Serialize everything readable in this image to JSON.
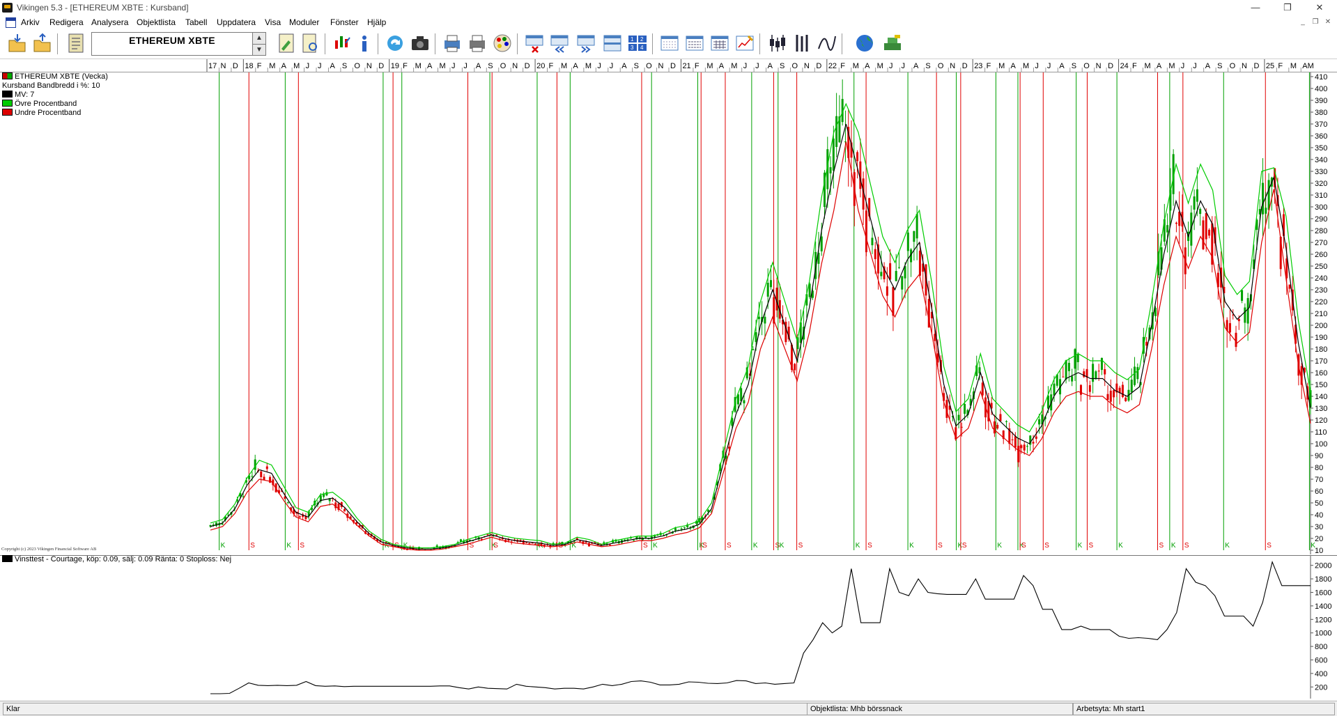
{
  "window": {
    "title": "Vikingen 5.3 - [ETHEREUM XBTE : Kursband]",
    "controls": {
      "minimize": "—",
      "maximize": "❐",
      "close": "✕"
    }
  },
  "menu": {
    "items": [
      "Arkiv",
      "Redigera",
      "Analysera",
      "Objektlista",
      "Tabell",
      "Uppdatera",
      "Visa",
      "Moduler",
      "Fönster",
      "Hjälp"
    ]
  },
  "toolbar": {
    "symbol": "ETHEREUM XBTE",
    "spin_up": "▲",
    "spin_down": "▼"
  },
  "legend": {
    "items": [
      {
        "label": "ETHEREUM XBTE (Vecka)",
        "color": "#cc0000",
        "color2": "#00aa00"
      },
      {
        "label": "Kursband  Bandbredd i %: 10",
        "color": ""
      },
      {
        "label": "MV: 7",
        "color": "#000000"
      },
      {
        "label": "Övre Procentband",
        "color": "#00cc00"
      },
      {
        "label": "Undre Procentband",
        "color": "#dd0000"
      }
    ]
  },
  "copyright": "Copyright (c) 2023 Vikingen Financial Software AB",
  "sub_legend": "Vinsttest - Courtage, köp: 0.09, sälj: 0.09  Ränta: 0  Stoploss: Nej",
  "status": {
    "left": "Klar",
    "middle": "Objektlista: Mhb börssnack",
    "right": "Arbetsyta: Mh start1"
  },
  "colors": {
    "buy": "#00a000",
    "sell": "#e00000",
    "ma": "#000000",
    "upper_band": "#00cc00",
    "lower_band": "#dd0000"
  },
  "chart_data": [
    {
      "type": "line",
      "name": "kursband",
      "series": [
        {
          "name": "MV: 7",
          "values": [
            30,
            33,
            45,
            65,
            78,
            75,
            58,
            42,
            38,
            52,
            54,
            46,
            34,
            24,
            17,
            14,
            12,
            11,
            11,
            12,
            14,
            17,
            20,
            23,
            20,
            18,
            17,
            16,
            14,
            15,
            19,
            17,
            14,
            16,
            18,
            20,
            20,
            22,
            26,
            28,
            32,
            45,
            85,
            125,
            150,
            200,
            230,
            200,
            170,
            215,
            280,
            330,
            370,
            330,
            290,
            250,
            230,
            255,
            270,
            215,
            150,
            115,
            125,
            160,
            125,
            115,
            105,
            100,
            115,
            140,
            155,
            160,
            155,
            155,
            145,
            140,
            148,
            200,
            260,
            305,
            275,
            305,
            285,
            220,
            205,
            215,
            300,
            325,
            265,
            185,
            130
          ]
        },
        {
          "name": "Övre Procentband",
          "values": [
            33,
            36,
            49,
            71,
            86,
            82,
            64,
            46,
            42,
            57,
            59,
            51,
            37,
            26,
            19,
            15,
            13,
            12,
            12,
            13,
            15,
            19,
            22,
            25,
            22,
            20,
            19,
            18,
            15,
            16,
            21,
            19,
            15,
            18,
            20,
            22,
            22,
            24,
            29,
            31,
            35,
            50,
            94,
            138,
            165,
            220,
            253,
            220,
            187,
            237,
            308,
            363,
            387,
            363,
            319,
            275,
            253,
            280,
            297,
            237,
            165,
            127,
            138,
            176,
            138,
            127,
            116,
            110,
            127,
            154,
            170,
            176,
            170,
            170,
            160,
            154,
            163,
            220,
            286,
            336,
            303,
            336,
            314,
            242,
            226,
            237,
            330,
            333,
            292,
            204,
            143
          ]
        },
        {
          "name": "Undre Procentband",
          "values": [
            27,
            30,
            41,
            59,
            70,
            68,
            52,
            38,
            34,
            47,
            49,
            41,
            31,
            22,
            15,
            13,
            11,
            10,
            10,
            11,
            13,
            15,
            18,
            21,
            18,
            16,
            15,
            14,
            13,
            14,
            17,
            15,
            13,
            14,
            16,
            18,
            18,
            20,
            23,
            25,
            29,
            41,
            77,
            113,
            135,
            180,
            207,
            180,
            153,
            194,
            252,
            297,
            355,
            297,
            261,
            225,
            207,
            230,
            243,
            194,
            135,
            104,
            113,
            144,
            113,
            104,
            95,
            90,
            104,
            126,
            140,
            144,
            140,
            140,
            131,
            126,
            133,
            180,
            234,
            275,
            248,
            275,
            257,
            198,
            185,
            194,
            270,
            315,
            239,
            167,
            117
          ]
        }
      ],
      "ylim": [
        10,
        410
      ],
      "y_ticks": [
        10,
        20,
        30,
        40,
        50,
        60,
        70,
        80,
        90,
        100,
        110,
        120,
        130,
        140,
        150,
        160,
        170,
        180,
        190,
        200,
        210,
        220,
        230,
        240,
        250,
        260,
        270,
        280,
        290,
        300,
        310,
        320,
        330,
        340,
        350,
        360,
        370,
        380,
        390,
        400,
        410
      ],
      "time_axis": [
        "17",
        "N",
        "D",
        "18",
        "F",
        "M",
        "A",
        "M",
        "J",
        "J",
        "A",
        "S",
        "O",
        "N",
        "D",
        "19",
        "F",
        "M",
        "A",
        "M",
        "J",
        "J",
        "A",
        "S",
        "O",
        "N",
        "D",
        "20",
        "F",
        "M",
        "A",
        "M",
        "J",
        "J",
        "A",
        "S",
        "O",
        "N",
        "D",
        "21",
        "F",
        "M",
        "A",
        "M",
        "J",
        "J",
        "A",
        "S",
        "O",
        "N",
        "D",
        "22",
        "F",
        "M",
        "A",
        "M",
        "J",
        "J",
        "A",
        "S",
        "O",
        "N",
        "D",
        "23",
        "F",
        "M",
        "A",
        "M",
        "J",
        "J",
        "A",
        "S",
        "O",
        "N",
        "D",
        "24",
        "F",
        "M",
        "A",
        "M",
        "J",
        "J",
        "A",
        "S",
        "O",
        "N",
        "D",
        "25",
        "F",
        "M",
        "AM"
      ],
      "signals": [
        {
          "label": "K",
          "pos": 0.008
        },
        {
          "label": "S",
          "pos": 0.035
        },
        {
          "label": "K",
          "pos": 0.068
        },
        {
          "label": "S",
          "pos": 0.08
        },
        {
          "label": "K",
          "pos": 0.157
        },
        {
          "label": "S",
          "pos": 0.166
        },
        {
          "label": "K",
          "pos": 0.174
        },
        {
          "label": "S",
          "pos": 0.234
        },
        {
          "label": "K",
          "pos": 0.254
        },
        {
          "label": "S",
          "pos": 0.256
        },
        {
          "label": "K",
          "pos": 0.297
        },
        {
          "label": "S",
          "pos": 0.315
        },
        {
          "label": "K",
          "pos": 0.327
        },
        {
          "label": "S",
          "pos": 0.392
        },
        {
          "label": "K",
          "pos": 0.401
        },
        {
          "label": "K",
          "pos": 0.443
        },
        {
          "label": "S",
          "pos": 0.446
        },
        {
          "label": "S",
          "pos": 0.468
        },
        {
          "label": "K",
          "pos": 0.492
        },
        {
          "label": "S",
          "pos": 0.512
        },
        {
          "label": "K",
          "pos": 0.516
        },
        {
          "label": "S",
          "pos": 0.533
        },
        {
          "label": "K",
          "pos": 0.585
        },
        {
          "label": "S",
          "pos": 0.596
        },
        {
          "label": "K",
          "pos": 0.634
        },
        {
          "label": "S",
          "pos": 0.66
        },
        {
          "label": "K",
          "pos": 0.678
        },
        {
          "label": "S",
          "pos": 0.682
        },
        {
          "label": "K",
          "pos": 0.714
        },
        {
          "label": "K",
          "pos": 0.734
        },
        {
          "label": "S",
          "pos": 0.736
        },
        {
          "label": "S",
          "pos": 0.757
        },
        {
          "label": "K",
          "pos": 0.787
        },
        {
          "label": "S",
          "pos": 0.797
        },
        {
          "label": "K",
          "pos": 0.824
        },
        {
          "label": "S",
          "pos": 0.861
        },
        {
          "label": "K",
          "pos": 0.872
        },
        {
          "label": "S",
          "pos": 0.884
        },
        {
          "label": "K",
          "pos": 0.921
        },
        {
          "label": "S",
          "pos": 0.959
        },
        {
          "label": "K",
          "pos": 0.999
        }
      ]
    },
    {
      "type": "line",
      "name": "vinsttest",
      "values": [
        100,
        100,
        105,
        180,
        260,
        225,
        220,
        225,
        220,
        225,
        280,
        220,
        210,
        215,
        205,
        210,
        210,
        210,
        210,
        210,
        210,
        210,
        210,
        210,
        215,
        215,
        190,
        170,
        200,
        180,
        175,
        170,
        240,
        210,
        200,
        190,
        170,
        180,
        180,
        170,
        200,
        240,
        220,
        240,
        280,
        290,
        270,
        230,
        230,
        240,
        275,
        270,
        255,
        250,
        260,
        295,
        290,
        250,
        260,
        240,
        250,
        260,
        700,
        900,
        1150,
        1000,
        1100,
        1950,
        1150,
        1150,
        1150,
        1950,
        1600,
        1550,
        1800,
        1600,
        1580,
        1570,
        1570,
        1570,
        1800,
        1500,
        1500,
        1500,
        1500,
        1850,
        1700,
        1350,
        1350,
        1050,
        1050,
        1100,
        1050,
        1050,
        1050,
        950,
        920,
        930,
        920,
        900,
        1050,
        1300,
        1950,
        1750,
        1700,
        1550,
        1250,
        1250,
        1250,
        1100,
        1450,
        2050,
        1700,
        1700,
        1700,
        1700
      ],
      "ylim": [
        100,
        2100
      ],
      "y_ticks": [
        200,
        400,
        600,
        800,
        1000,
        1200,
        1400,
        1600,
        1800,
        2000
      ]
    }
  ]
}
